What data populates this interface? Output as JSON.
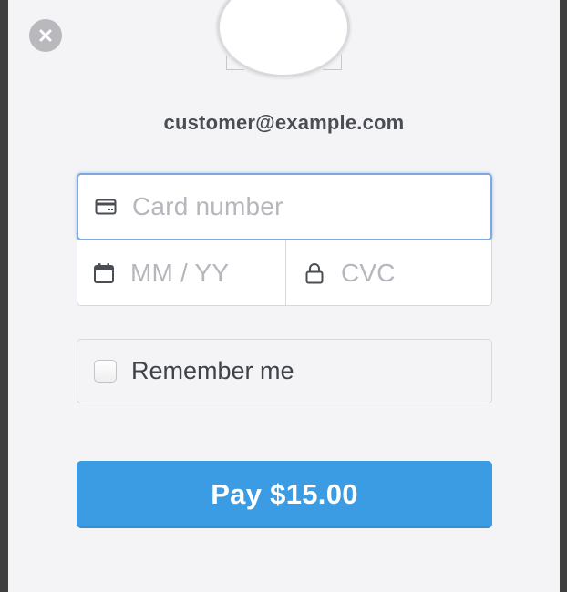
{
  "checkout": {
    "email": "customer@example.com",
    "card_number": {
      "placeholder": "Card number",
      "icon": "credit-card-icon"
    },
    "expiry": {
      "placeholder": "MM / YY",
      "icon": "calendar-icon"
    },
    "cvc": {
      "placeholder": "CVC",
      "icon": "lock-icon"
    },
    "remember_me": {
      "label": "Remember me",
      "checked": false
    },
    "pay_button": {
      "label": "Pay $15.00"
    },
    "close": {
      "icon": "close-icon"
    },
    "logo": {
      "icon": "merchant-logo-placeholder"
    }
  },
  "colors": {
    "accent": "#3c9ce3",
    "focus_border": "#7fa8e0",
    "placeholder": "#b5b7bd",
    "background": "#f4f4f6"
  }
}
